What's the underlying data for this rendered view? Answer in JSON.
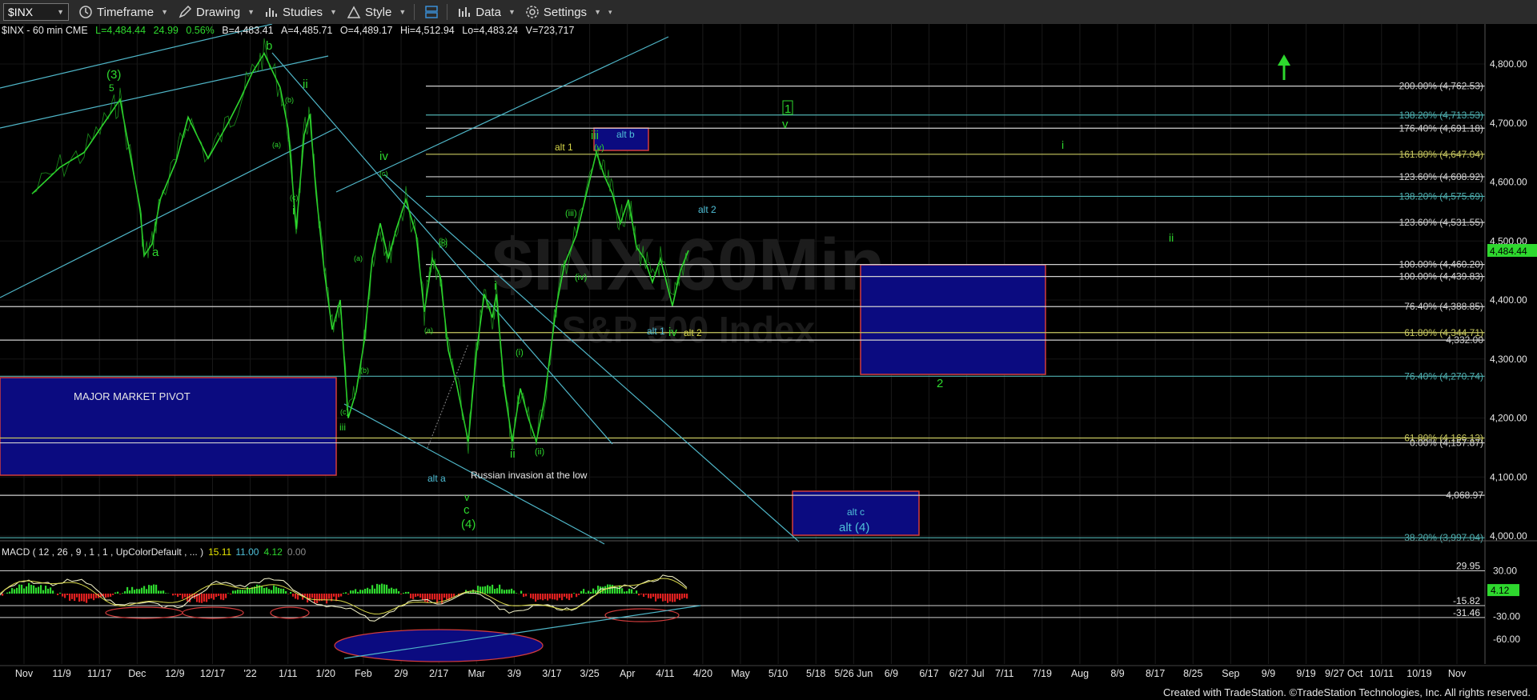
{
  "toolbar": {
    "symbol": "$INX",
    "items": [
      "Timeframe",
      "Drawing",
      "Studies",
      "Style",
      "Data",
      "Settings"
    ]
  },
  "info_bar": {
    "symbol": "$INX - 60 min  CME",
    "last": "L=4,484.44",
    "change": "24.99",
    "pct": "0.56%",
    "bid": "B=4,483.41",
    "ask": "A=4,485.71",
    "open": "O=4,489.17",
    "high": "Hi=4,512.94",
    "low": "Lo=4,483.24",
    "volume": "V=723,717"
  },
  "macd_bar": {
    "label": "MACD ( 12 , 26 , 9 , 1 , 1 , UpColorDefault , ... )",
    "v1": "15.11",
    "v2": "11.00",
    "v3": "4.12",
    "v4": "0.00"
  },
  "watermark": {
    "line1": "$INX,60Min",
    "line2": "S&P 500 Index"
  },
  "chart_data": {
    "type": "line",
    "title": "$INX - 60 min",
    "y_axis": {
      "ticks": [
        4000,
        4100,
        4200,
        4300,
        4400,
        4500,
        4600,
        4700,
        4800
      ],
      "labels": [
        "4,000.00",
        "4,100.00",
        "4,200.00",
        "4,300.00",
        "4,400.00",
        "4,500.00",
        "4,600.00",
        "4,700.00",
        "4,800.00"
      ],
      "ylim": [
        3975,
        4835
      ]
    },
    "current_price": "4,484.44",
    "x_axis": {
      "labels": [
        "Nov",
        "11/9",
        "11/17",
        "Dec",
        "12/9",
        "12/17",
        "'22",
        "1/11",
        "1/20",
        "Feb",
        "2/9",
        "2/17",
        "Mar",
        "3/9",
        "3/17",
        "3/25",
        "Apr",
        "4/11",
        "4/20",
        "May",
        "5/10",
        "5/18",
        "5/26 Jun",
        "6/9",
        "6/17",
        "6/27 Jul",
        "7/11",
        "7/19",
        "Aug",
        "8/9",
        "8/17",
        "8/25",
        "Sep",
        "9/9",
        "9/19",
        "9/27 Oct",
        "10/11",
        "10/19",
        "Nov"
      ]
    },
    "price_points": [
      [
        4.0,
        4580
      ],
      [
        7.5,
        4625
      ],
      [
        10.5,
        4650
      ],
      [
        13.5,
        4710
      ],
      [
        15,
        4740
      ],
      [
        17.5,
        4555
      ],
      [
        18,
        4475
      ],
      [
        19,
        4495
      ],
      [
        20,
        4570
      ],
      [
        22,
        4635
      ],
      [
        23.5,
        4710
      ],
      [
        26,
        4640
      ],
      [
        28.5,
        4700
      ],
      [
        30,
        4740
      ],
      [
        31.5,
        4785
      ],
      [
        33.0,
        4818
      ],
      [
        35,
        4760
      ],
      [
        36,
        4690
      ],
      [
        37,
        4520
      ],
      [
        38,
        4680
      ],
      [
        38.7,
        4715
      ],
      [
        39.5,
        4580
      ],
      [
        40.5,
        4450
      ],
      [
        41.5,
        4350
      ],
      [
        42.5,
        4400
      ],
      [
        43.5,
        4200
      ],
      [
        44.5,
        4245
      ],
      [
        45.5,
        4330
      ],
      [
        46.5,
        4470
      ],
      [
        47.5,
        4530
      ],
      [
        48.5,
        4470
      ],
      [
        49.5,
        4520
      ],
      [
        50.7,
        4570
      ],
      [
        52,
        4510
      ],
      [
        53,
        4380
      ],
      [
        54,
        4470
      ],
      [
        55,
        4440
      ],
      [
        56,
        4315
      ],
      [
        57,
        4260
      ],
      [
        58.5,
        4160
      ],
      [
        59.5,
        4310
      ],
      [
        60.5,
        4410
      ],
      [
        61.5,
        4370
      ],
      [
        62,
        4410
      ],
      [
        63,
        4250
      ],
      [
        64,
        4160
      ],
      [
        65,
        4250
      ],
      [
        66,
        4200
      ],
      [
        67,
        4160
      ],
      [
        68,
        4230
      ],
      [
        69.5,
        4390
      ],
      [
        70.5,
        4460
      ],
      [
        72.0,
        4510
      ],
      [
        74.5,
        4650
      ],
      [
        75.5,
        4610
      ],
      [
        76.5,
        4580
      ],
      [
        77.5,
        4530
      ],
      [
        78.5,
        4570
      ],
      [
        79.5,
        4490
      ],
      [
        80.5,
        4470
      ],
      [
        81.5,
        4430
      ],
      [
        82.5,
        4470
      ],
      [
        84,
        4390
      ],
      [
        85,
        4450
      ],
      [
        86,
        4484
      ]
    ],
    "macd": {
      "MACD": 15.11,
      "Signal": 11.0,
      "Diff": 4.12,
      "Zero": 0.0,
      "ticks": [
        30,
        -30,
        -60
      ],
      "levels": [
        "29.95",
        "-15.82",
        "-31.46"
      ],
      "current": "4.12"
    },
    "fib_levels": [
      {
        "label": "200.00% (4,762.53)",
        "value": 4762.53,
        "color": "#d0d0d0"
      },
      {
        "label": "138.20% (4,713.53)",
        "value": 4713.53,
        "color": "#4fb0b0"
      },
      {
        "label": "176.40% (4,691.18)",
        "value": 4691.18,
        "color": "#d0d0d0"
      },
      {
        "label": "161.80% (4,647.04)",
        "value": 4647.04,
        "color": "#c8c860"
      },
      {
        "label": "123.60% (4,608.92)",
        "value": 4608.92,
        "color": "#d0d0d0"
      },
      {
        "label": "138.20% (4,575.69)",
        "value": 4575.69,
        "color": "#4fb0b0"
      },
      {
        "label": "123.60% (4,531.55)",
        "value": 4531.55,
        "color": "#d0d0d0"
      },
      {
        "label": "100.00% (4,460.20)",
        "value": 4460.2,
        "color": "#d0d0d0"
      },
      {
        "label": "100.00% (4,439.83)",
        "value": 4439.83,
        "color": "#d0d0d0"
      },
      {
        "label": "76.40% (4,388.85)",
        "value": 4388.85,
        "color": "#d0d0d0"
      },
      {
        "label": "61.80% (4,344.71)",
        "value": 4344.71,
        "color": "#c8c860"
      },
      {
        "label": "4,332.00",
        "value": 4332.0,
        "color": "#d0d0d0"
      },
      {
        "label": "76.40% (4,270.74)",
        "value": 4270.74,
        "color": "#4fb0b0"
      },
      {
        "label": "61.80% (4,166.13)",
        "value": 4166.13,
        "color": "#c8c860"
      },
      {
        "label": "0.00% (4,157.87)",
        "value": 4157.87,
        "color": "#d0d0d0"
      },
      {
        "label": "4,068.97",
        "value": 4068.97,
        "color": "#d0d0d0"
      },
      {
        "label": "38.20% (3,997.04)",
        "value": 3997.04,
        "color": "#4fb0b0"
      }
    ]
  },
  "annotations": {
    "boxes": [
      {
        "label": "MAJOR MARKET PIVOT"
      },
      {
        "label": "alt b"
      },
      {
        "label": "alt c"
      },
      {
        "label": "alt (4)"
      }
    ],
    "green_labels": [
      "(3)",
      "5",
      "b",
      "ii",
      "a",
      "(b)",
      "(a)",
      "(c)",
      "i",
      "iv",
      "(c)",
      "(b)",
      "(a)",
      "(b)",
      "(c)",
      "iii",
      "v",
      "c",
      "(4)",
      "i",
      "(i)",
      "(ii)",
      "ii",
      "(iii)",
      "(iv)",
      "iii",
      "(v)",
      "iv",
      "2",
      "1",
      "v",
      "i",
      "ii",
      "(b)",
      "(a)"
    ],
    "cyan_labels": [
      "alt a",
      "alt 1",
      "alt 2"
    ],
    "yellow_labels": [
      "alt 1",
      "alt 2"
    ],
    "white_labels": [
      "Russian invasion at the low"
    ]
  },
  "footer": "Created with TradeStation. ©TradeStation Technologies, Inc. All rights reserved."
}
